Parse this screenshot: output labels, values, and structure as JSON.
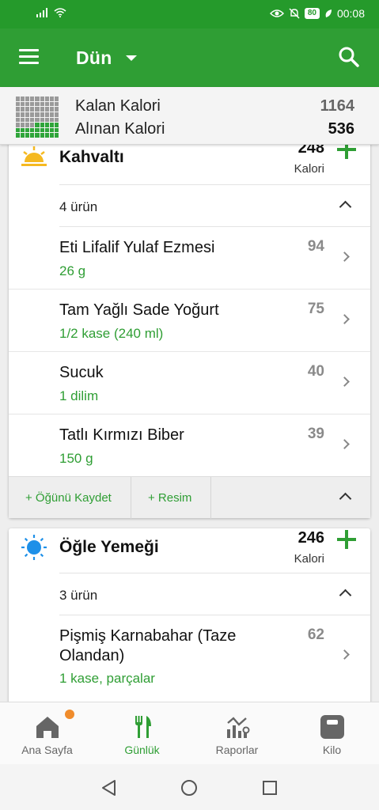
{
  "status": {
    "battery": "80",
    "time": "00:08"
  },
  "appbar": {
    "title": "Dün"
  },
  "summary": {
    "remaining_label": "Kalan Kalori",
    "remaining_value": "1164",
    "consumed_label": "Alınan Kalori",
    "consumed_value": "536"
  },
  "meals": [
    {
      "name": "Kahvaltı",
      "calories": "248",
      "unit": "Kalori",
      "count": "4 ürün",
      "items": [
        {
          "name": "Eti Lifalif Yulaf Ezmesi",
          "amount": "26 g",
          "calories": "94"
        },
        {
          "name": "Tam Yağlı Sade Yoğurt",
          "amount": "1/2 kase (240 ml)",
          "calories": "75"
        },
        {
          "name": "Sucuk",
          "amount": "1 dilim",
          "calories": "40"
        },
        {
          "name": "Tatlı Kırmızı Biber",
          "amount": "150 g",
          "calories": "39"
        }
      ],
      "save_label": "+ Öğünü Kaydet",
      "photo_label": "+ Resim"
    },
    {
      "name": "Öğle Yemeği",
      "calories": "246",
      "unit": "Kalori",
      "count": "3 ürün",
      "items": [
        {
          "name": "Pişmiş Karnabahar (Taze Olandan)",
          "amount": "1  kase, parçalar",
          "calories": "62"
        }
      ]
    }
  ],
  "bottomnav": [
    {
      "label": "Ana Sayfa"
    },
    {
      "label": "Günlük"
    },
    {
      "label": "Raporlar"
    },
    {
      "label": "Kilo"
    }
  ],
  "colors": {
    "primary": "#2f9e34",
    "statusbar": "#259a2b",
    "badge": "#f08c2c"
  }
}
